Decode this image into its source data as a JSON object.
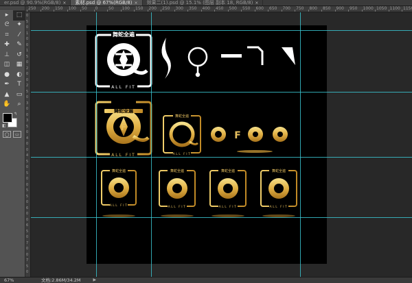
{
  "tabs": [
    {
      "label": "er.psd @ 90.9%(RGB/8)",
      "active": false
    },
    {
      "label": "素材.psd @ 67%(RGB/8)",
      "active": true
    },
    {
      "label": "效果二(1).psd @ 15.1% (图层 副本 18, RGB/8)",
      "active": false
    }
  ],
  "tab_close_glyph": "×",
  "ruler_top": [
    "250",
    "200",
    "150",
    "100",
    "50",
    "0",
    "50",
    "100",
    "150",
    "200",
    "250",
    "300",
    "350",
    "400",
    "450",
    "500",
    "550",
    "600",
    "650",
    "700",
    "750",
    "800",
    "850",
    "900",
    "950",
    "1000",
    "1050",
    "1100",
    "1150"
  ],
  "ruler_left": [
    "0",
    "5",
    "0",
    "1",
    "0",
    "0",
    "1",
    "5",
    "0",
    "2",
    "0",
    "0",
    "2",
    "5",
    "0",
    "3",
    "0",
    "0",
    "3",
    "5",
    "0",
    "4",
    "0",
    "0",
    "4",
    "5",
    "0",
    "5",
    "0",
    "0",
    "5",
    "5",
    "0",
    "6",
    "0",
    "0",
    "6",
    "5",
    "0",
    "7",
    "0",
    "0",
    "7",
    "5",
    "0"
  ],
  "tools": [
    {
      "icon": "▸",
      "name": "move-tool"
    },
    {
      "icon": "⬚",
      "name": "marquee-tool"
    },
    {
      "icon": "ᘓ",
      "name": "lasso-tool"
    },
    {
      "icon": "✦",
      "name": "quick-select-tool"
    },
    {
      "icon": "⌗",
      "name": "crop-tool"
    },
    {
      "icon": "⁄",
      "name": "eyedropper-tool"
    },
    {
      "icon": "✚",
      "name": "healing-brush-tool"
    },
    {
      "icon": "✎",
      "name": "brush-tool"
    },
    {
      "icon": "⊥",
      "name": "clone-stamp-tool"
    },
    {
      "icon": "↺",
      "name": "history-brush-tool"
    },
    {
      "icon": "◫",
      "name": "eraser-tool"
    },
    {
      "icon": "▦",
      "name": "gradient-tool"
    },
    {
      "icon": "●",
      "name": "blur-tool"
    },
    {
      "icon": "◐",
      "name": "dodge-tool"
    },
    {
      "icon": "✒",
      "name": "pen-tool"
    },
    {
      "icon": "T",
      "name": "type-tool"
    },
    {
      "icon": "▲",
      "name": "path-select-tool"
    },
    {
      "icon": "▭",
      "name": "shape-tool"
    },
    {
      "icon": "✋",
      "name": "hand-tool"
    },
    {
      "icon": "⌕",
      "name": "zoom-tool"
    }
  ],
  "color_swap_glyph": "↰",
  "color_default_glyph": "◧",
  "quickmask_glyphs": [
    "◯",
    "▭"
  ],
  "colors": {
    "foreground": "#000000",
    "background": "#ffffff",
    "guide": "#39c3cf",
    "gold": "#e7c060"
  },
  "logo_main": {
    "title": "舞蛇全遍",
    "sub": "ALL FIT",
    "glyph": "F"
  },
  "pieces_row1": [
    "slash-curve",
    "circle-stem",
    "minus-bar",
    "corner-hook",
    "angle-stroke"
  ],
  "row2_letter": "F",
  "status": {
    "zoom": "67%",
    "doc": "文档:2.86M/34.2M",
    "arrow": "▶"
  }
}
